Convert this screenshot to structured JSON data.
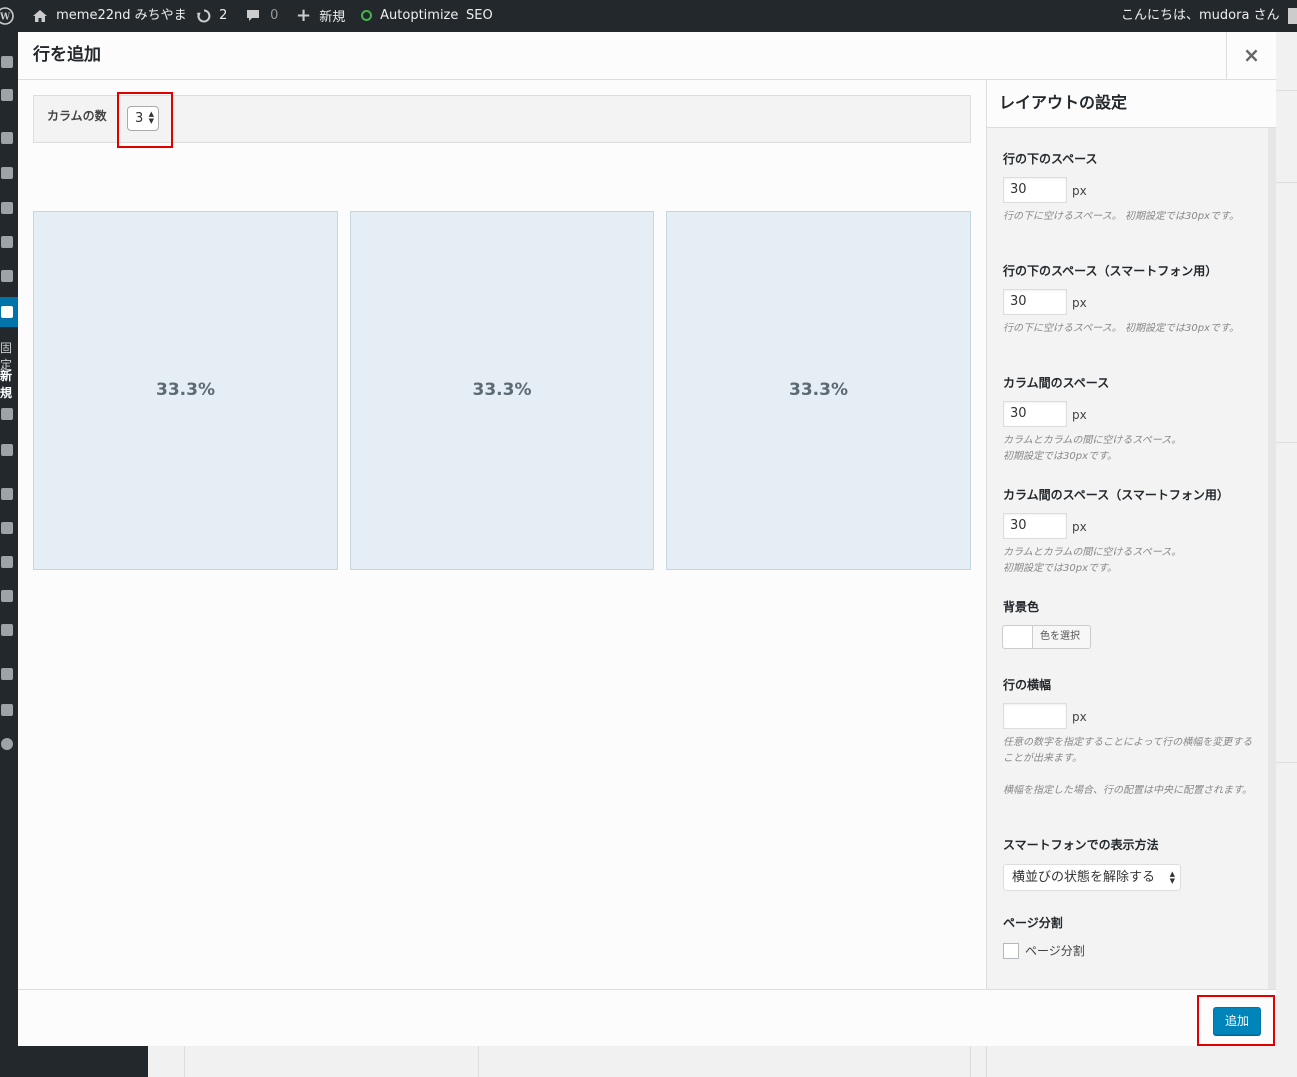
{
  "adminbar": {
    "site_name": "meme22nd みちやま",
    "updates_count": "2",
    "comments_count": "0",
    "new_label": "新規",
    "autoptimize_label": "Autoptimize",
    "seo_label": "SEO",
    "greeting": "こんにちは、mudora さん"
  },
  "leftmenu": {
    "fixed_label": "固定",
    "new_label": "新規"
  },
  "modal": {
    "title": "行を追加",
    "close_label": "×",
    "column_count_label": "カラムの数",
    "column_count_value": "3",
    "columns": [
      {
        "label": "33.3%"
      },
      {
        "label": "33.3%"
      },
      {
        "label": "33.3%"
      }
    ],
    "add_button": "追加"
  },
  "sidebar": {
    "title": "レイアウトの設定",
    "row_bottom_space": {
      "label": "行の下のスペース",
      "value": "30",
      "unit": "px",
      "desc": "行の下に空けるスペース。 初期設定では30pxです。"
    },
    "row_bottom_space_sp": {
      "label": "行の下のスペース（スマートフォン用）",
      "value": "30",
      "unit": "px",
      "desc": "行の下に空けるスペース。 初期設定では30pxです。"
    },
    "column_space": {
      "label": "カラム間のスペース",
      "value": "30",
      "unit": "px",
      "desc1": "カラムとカラムの間に空けるスペース。",
      "desc2": "初期設定では30pxです。"
    },
    "column_space_sp": {
      "label": "カラム間のスペース（スマートフォン用）",
      "value": "30",
      "unit": "px",
      "desc1": "カラムとカラムの間に空けるスペース。",
      "desc2": "初期設定では30pxです。"
    },
    "bg_color": {
      "label": "背景色",
      "button": "色を選択",
      "value": "#ffffff"
    },
    "row_width": {
      "label": "行の横幅",
      "value": "",
      "unit": "px",
      "desc1": "任意の数字を指定することによって行の横幅を変更することが出来ます。",
      "desc2": "横幅を指定した場合、行の配置は中央に配置されます。"
    },
    "sp_display": {
      "label": "スマートフォンでの表示方法",
      "selected": "横並びの状態を解除する"
    },
    "page_break": {
      "label": "ページ分割",
      "checkbox_label": "ページ分割",
      "checked": false
    }
  },
  "colors": {
    "accent": "#0085ba",
    "highlight": "#e00000",
    "column_bg": "#e4eef4",
    "adminbar_bg": "#23282d",
    "autoptimize_status": "#4caf50"
  }
}
